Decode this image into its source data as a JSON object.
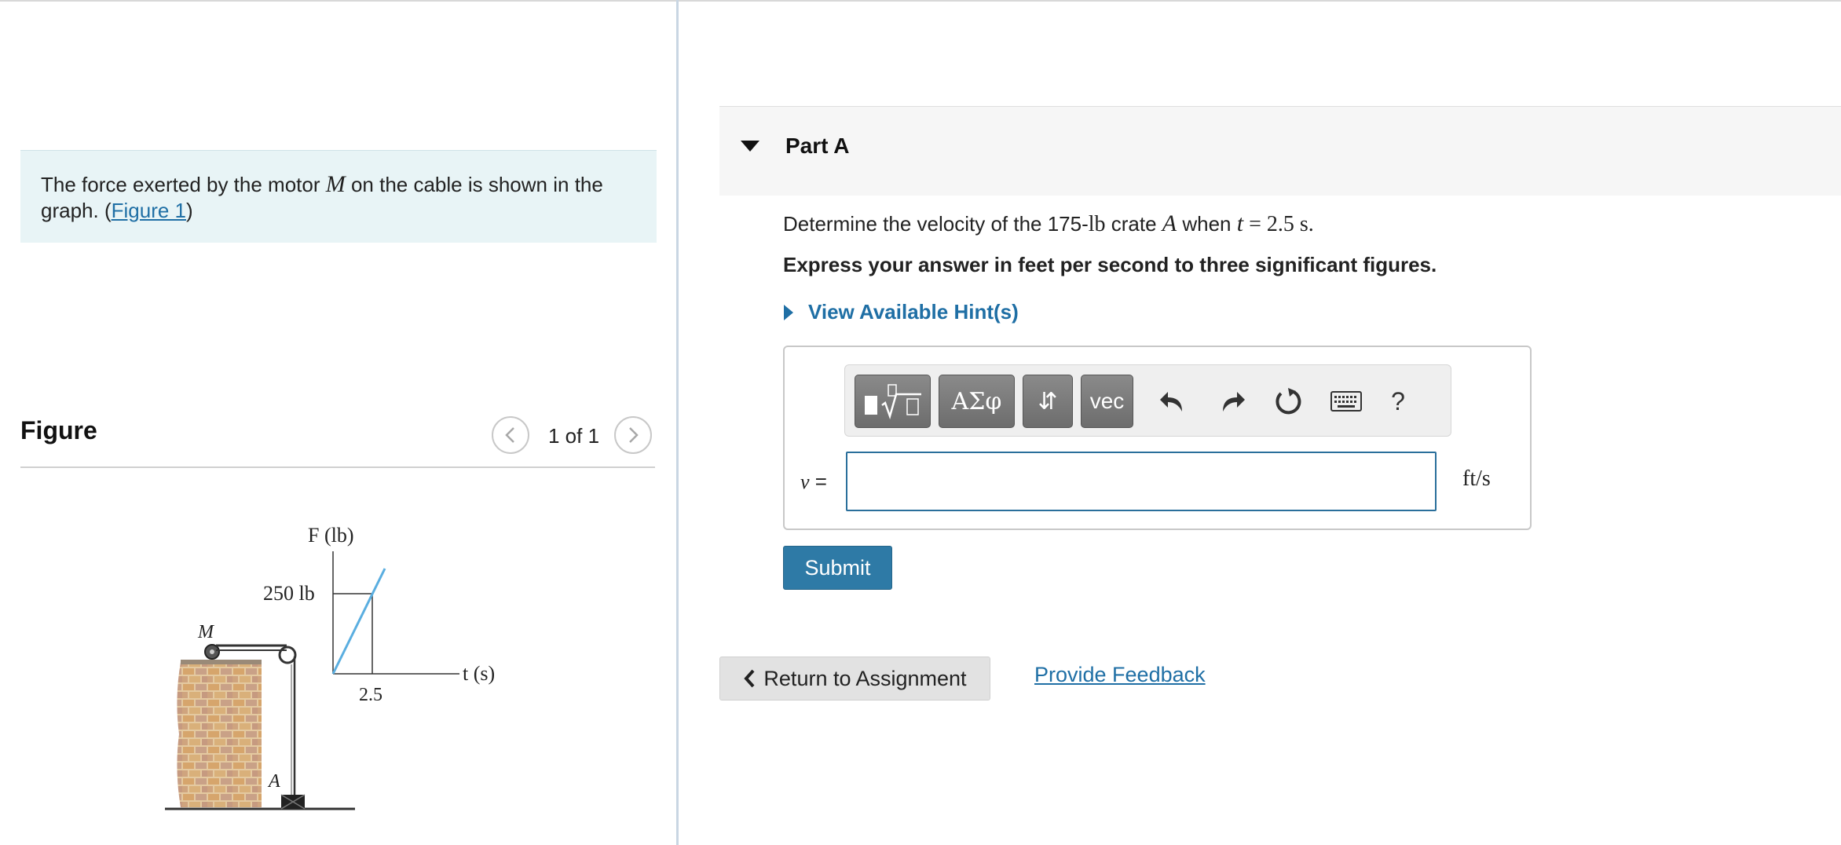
{
  "problem": {
    "text_before": "The force exerted by the motor ",
    "motor_symbol": "M",
    "text_after": " on the cable is shown in the graph. (",
    "figure_link": "Figure 1",
    "close_paren": ")"
  },
  "figure_panel": {
    "title": "Figure",
    "pager": "1 of 1"
  },
  "figure": {
    "y_axis_label": "F (lb)",
    "force_label": "250 lb",
    "x_axis_label": "t (s)",
    "t_tick": "2.5",
    "motor_label": "M",
    "crate_label": "A"
  },
  "part": {
    "title": "Part A",
    "question_prefix": "Determine the velocity of the 175-",
    "question_unit": "lb",
    "question_mid": " crate ",
    "crate_symbol": "A",
    "question_when": " when ",
    "t_symbol": "t",
    "t_value": " = 2.5 s.",
    "instruction": "Express your answer in feet per second to three significant figures.",
    "hint_label": "View Available Hint(s)"
  },
  "toolbar": {
    "greek_label": "ΑΣφ",
    "arrows_label": "⇵",
    "vec_label": "vec",
    "help_label": "?"
  },
  "answer": {
    "variable": "v",
    "equals": " =",
    "value": "",
    "unit": "ft/s"
  },
  "buttons": {
    "submit": "Submit",
    "return": "Return to Assignment",
    "feedback": "Provide Feedback"
  },
  "colors": {
    "accent": "#2e7aa6",
    "link": "#1f6fa5",
    "problem_bg": "#e8f4f6",
    "graph_line": "#5aaee0"
  }
}
